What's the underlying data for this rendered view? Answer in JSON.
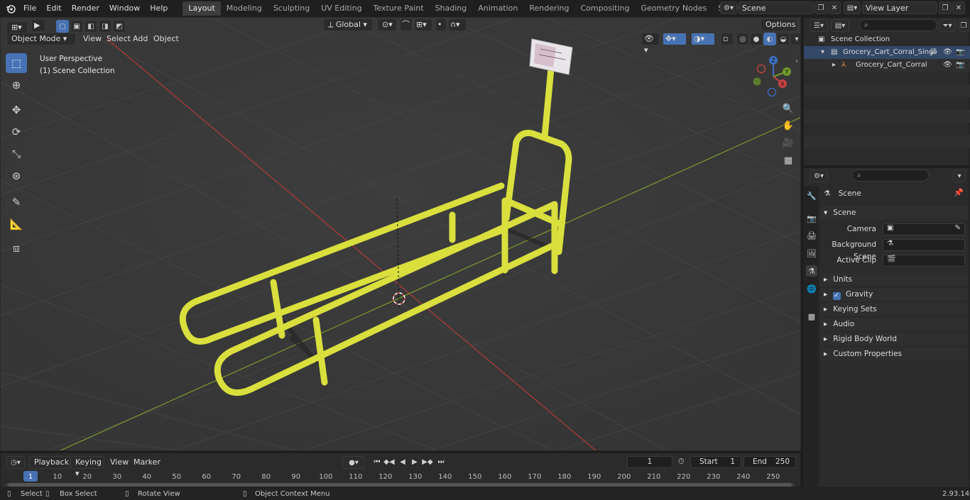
{
  "topbar": {
    "menus": [
      "File",
      "Edit",
      "Render",
      "Window",
      "Help"
    ],
    "workspaces": [
      "Layout",
      "Modeling",
      "Sculpting",
      "UV Editing",
      "Texture Paint",
      "Shading",
      "Animation",
      "Rendering",
      "Compositing",
      "Geometry Nodes",
      "Scripting"
    ],
    "active_workspace": "Layout",
    "scene_name": "Scene",
    "view_layer_name": "View Layer"
  },
  "viewport": {
    "mode": "Object Mode",
    "menus": [
      "View",
      "Select",
      "Add",
      "Object"
    ],
    "transform_orientation": "Global",
    "options_label": "Options",
    "perspective_label": "User Perspective",
    "collection_label": "(1) Scene Collection",
    "gizmo": {
      "x": "X",
      "y": "Y",
      "z": "Z"
    }
  },
  "outliner": {
    "root": "Scene Collection",
    "items": [
      "Grocery_Cart_Corral_Single_Y",
      "Grocery_Cart_Corral_Sing"
    ]
  },
  "properties": {
    "header": "Scene",
    "panel": "Scene",
    "fields": [
      {
        "label": "Camera"
      },
      {
        "label": "Background Scene"
      },
      {
        "label": "Active Clip"
      }
    ],
    "sections": [
      "Units",
      "Gravity",
      "Keying Sets",
      "Audio",
      "Rigid Body World",
      "Custom Properties"
    ]
  },
  "timeline": {
    "menus": [
      "Playback",
      "Keying",
      "View",
      "Marker"
    ],
    "current_frame": "1",
    "start_label": "Start",
    "start_value": "1",
    "end_label": "End",
    "end_value": "250",
    "ruler": [
      "1",
      "10",
      "20",
      "30",
      "40",
      "50",
      "60",
      "70",
      "80",
      "90",
      "100",
      "110",
      "120",
      "130",
      "140",
      "150",
      "160",
      "170",
      "180",
      "190",
      "200",
      "210",
      "220",
      "230",
      "240",
      "250"
    ]
  },
  "statusbar": {
    "select": "Select",
    "box_select": "Box Select",
    "rotate_view": "Rotate View",
    "context_menu": "Object Context Menu",
    "version": "2.93.14"
  },
  "colors": {
    "object_yellow": "#d9df3d",
    "accent_blue": "#4772b3",
    "axis_red": "#b03a3a",
    "axis_green": "#7a9a2c"
  }
}
